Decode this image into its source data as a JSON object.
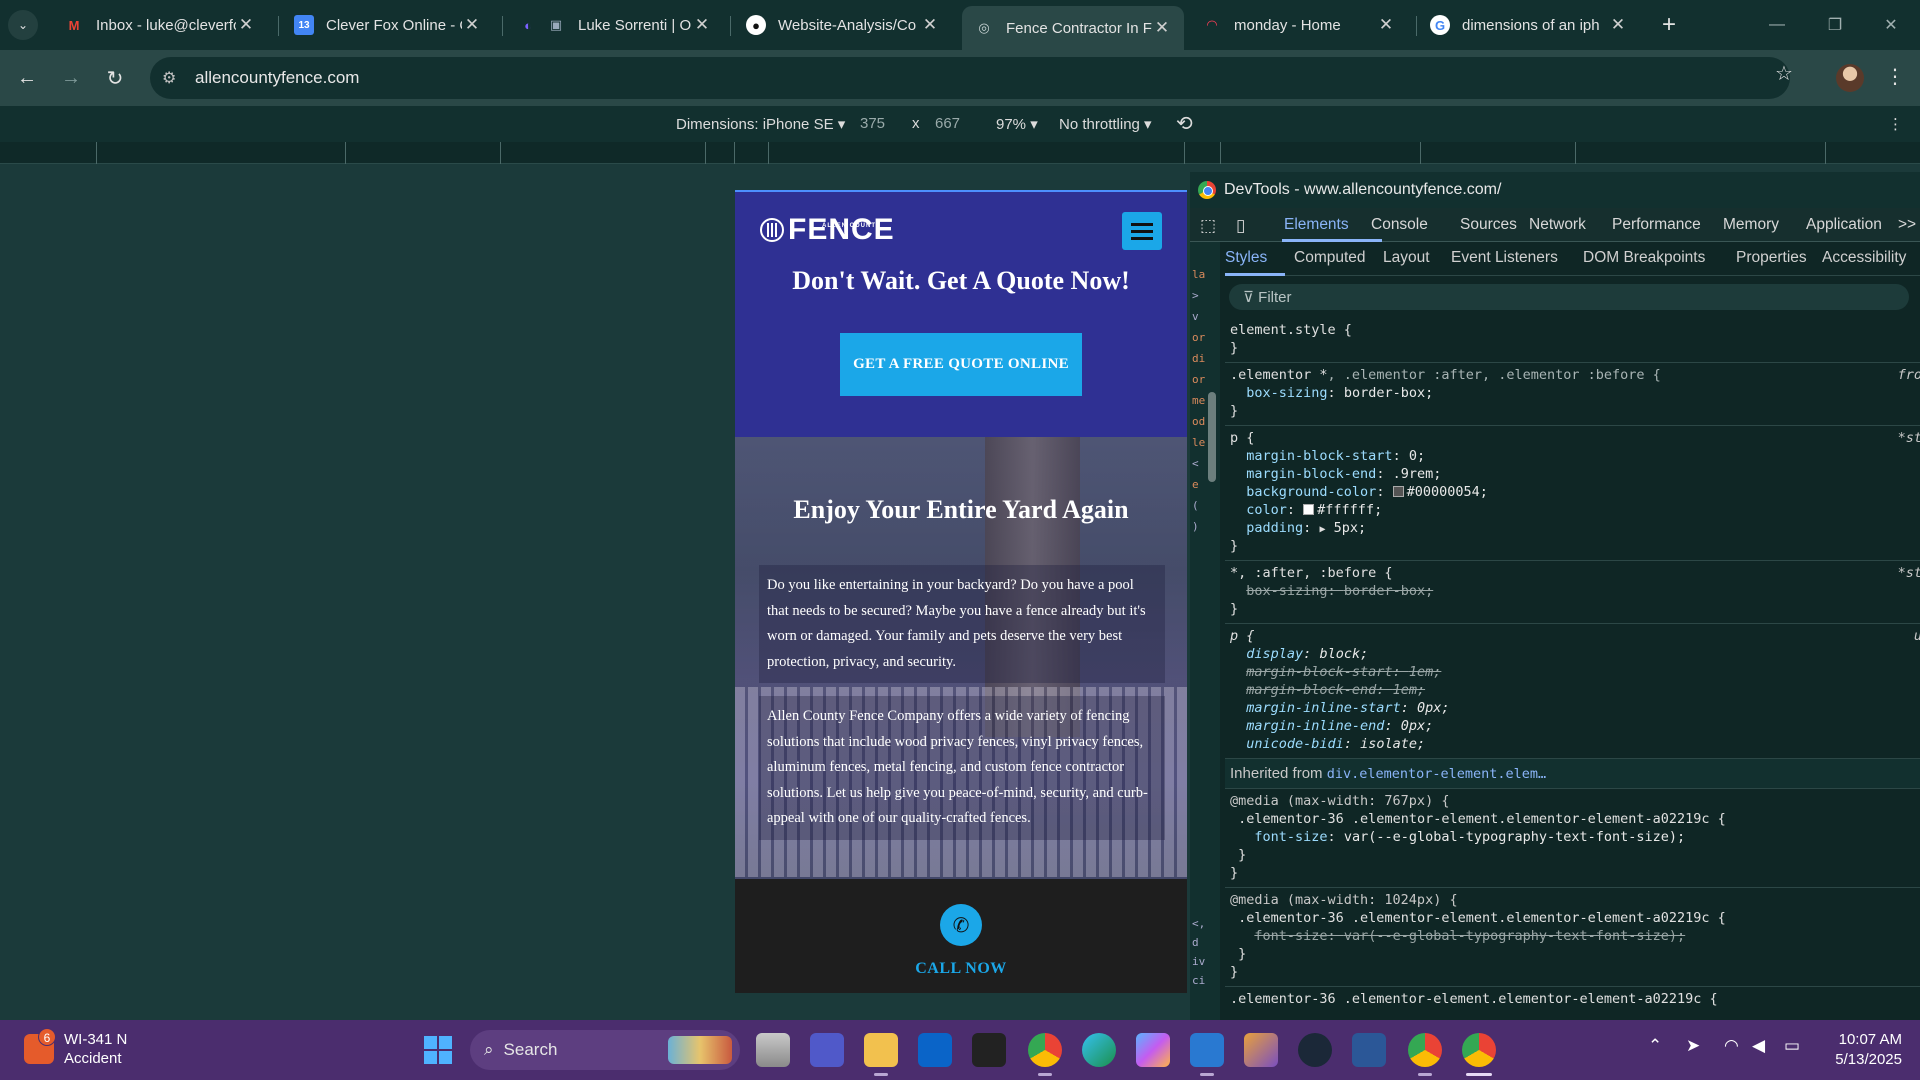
{
  "browser": {
    "tabs": [
      {
        "label": "Inbox - luke@cleverfc",
        "favicon": "gmail-icon",
        "icon_color": "#ea4335"
      },
      {
        "label": "Clever Fox Online - C",
        "favicon": "calendar-icon",
        "icon_color": "#4285f4"
      },
      {
        "label": "Luke Sorrenti | Op",
        "favicon": "profile-icon",
        "icon_color": "#7b61ff"
      },
      {
        "label": "Website-Analysis/Co",
        "favicon": "github-icon",
        "icon_color": "#ffffff"
      },
      {
        "label": "Fence Contractor In F",
        "favicon": "globe-icon",
        "icon_color": "#9ab"
      },
      {
        "label": "monday - Home",
        "favicon": "monday-icon",
        "icon_color": "#ff3d57"
      },
      {
        "label": "dimensions of an iph",
        "favicon": "google-icon",
        "icon_color": "#4285f4"
      }
    ],
    "active_tab": 4,
    "url": "allencountyfence.com",
    "device_toolbar": {
      "dimensions_label": "Dimensions: iPhone SE",
      "width": "375",
      "times": "x",
      "height": "667",
      "zoom": "97%",
      "throttling": "No throttling"
    }
  },
  "site": {
    "logo_small": "ALLEN COUNTY",
    "logo_text": "FENCE",
    "header_title": "Don't Wait. Get A Quote Now!",
    "cta_label": "GET A FREE QUOTE ONLINE",
    "hero_title": "Enjoy Your Entire Yard Again",
    "para1": "Do you like entertaining in your backyard? Do you have a pool that needs to be secured? Maybe you have a fence already but it's worn or damaged. Your family and pets deserve the very best protection, privacy, and security.",
    "para2": "Allen County Fence Company offers a wide variety of fencing solutions that include wood privacy fences, vinyl privacy fences, aluminum fences, metal fencing, and custom fence contractor solutions. Let us help give you peace-of-mind, security, and curb-appeal with one of our quality-crafted fences.",
    "call_label": "CALL NOW"
  },
  "devtools": {
    "title": "DevTools - www.allencountyfence.com/",
    "tabs": [
      "Elements",
      "Console",
      "Sources",
      "Network",
      "Performance",
      "Memory",
      "Application"
    ],
    "more": ">>",
    "subtabs": [
      "Styles",
      "Computed",
      "Layout",
      "Event Listeners",
      "DOM Breakpoints",
      "Properties",
      "Accessibility"
    ],
    "filter_placeholder": "Filter",
    "left_gutter": [
      "la",
      ">",
      "v",
      "or",
      "di",
      "or",
      "me",
      "od",
      "le",
      "<",
      "e",
      "(",
      ")",
      "<,",
      "d",
      "iv",
      "ci"
    ],
    "element_style": "element.style {",
    "close_brace": "}",
    "rule1_selector": ".elementor *",
    "rule1_selector_rest": ", .elementor :after, .elementor :before {",
    "rule1_src": "fro",
    "rule1_prop": "box-sizing",
    "rule1_val": "border-box;",
    "rule2_selector": "p {",
    "rule2_src": "*st",
    "rule2": [
      {
        "prop": "margin-block-start",
        "val": "0;"
      },
      {
        "prop": "margin-block-end",
        "val": ".9rem;"
      },
      {
        "prop": "background-color",
        "val": "#00000054;",
        "swatch": "#545454"
      },
      {
        "prop": "color",
        "val": "#ffffff;",
        "swatch": "#ffffff"
      },
      {
        "prop": "padding",
        "val": "5px;",
        "arrow": true
      }
    ],
    "rule3_selector": "*, :after, :before {",
    "rule3_src": "*st",
    "rule3_prop": "box-sizing",
    "rule3_val": "border-box;",
    "rule4_selector": "p {",
    "rule4_src": "u",
    "rule4": [
      {
        "prop": "display",
        "val": "block;",
        "struck": false
      },
      {
        "prop": "margin-block-start",
        "val": "1em;",
        "struck": true
      },
      {
        "prop": "margin-block-end",
        "val": "1em;",
        "struck": true
      },
      {
        "prop": "margin-inline-start",
        "val": "0px;",
        "struck": false
      },
      {
        "prop": "margin-inline-end",
        "val": "0px;",
        "struck": false
      },
      {
        "prop": "unicode-bidi",
        "val": "isolate;",
        "struck": false
      }
    ],
    "inherited_label": "Inherited from",
    "inherited_link": "div.elementor-element.elem…",
    "media1": "@media (max-width: 767px) {",
    "media1_selector": ".elementor-36 .elementor-element.elementor-element-a02219c {",
    "media1_prop": "font-size",
    "media1_val": "var(--e-global-typography-text-font-size);",
    "media2": "@media (max-width: 1024px) {",
    "media2_selector": ".elementor-36 .elementor-element.elementor-element-a02219c {",
    "media2_prop": "font-size",
    "media2_val": "var(--e-global-typography-text-font-size);",
    "last_line": ".elementor-36 .elementor-element.elementor-element-a02219c {"
  },
  "taskbar": {
    "weather_badge": "6",
    "weather_line1": "WI-341 N",
    "weather_line2": "Accident",
    "search_label": "Search",
    "apps": [
      "file-explorer-icon",
      "teams-icon",
      "folder-icon",
      "outlook-icon",
      "alienware-icon",
      "chrome-icon",
      "edge-icon",
      "copilot-icon",
      "vscode-icon",
      "git-icon",
      "steam-icon",
      "powershell-icon",
      "chrome-icon",
      "chrome-icon"
    ],
    "time": "10:07 AM",
    "date": "5/13/2025"
  }
}
